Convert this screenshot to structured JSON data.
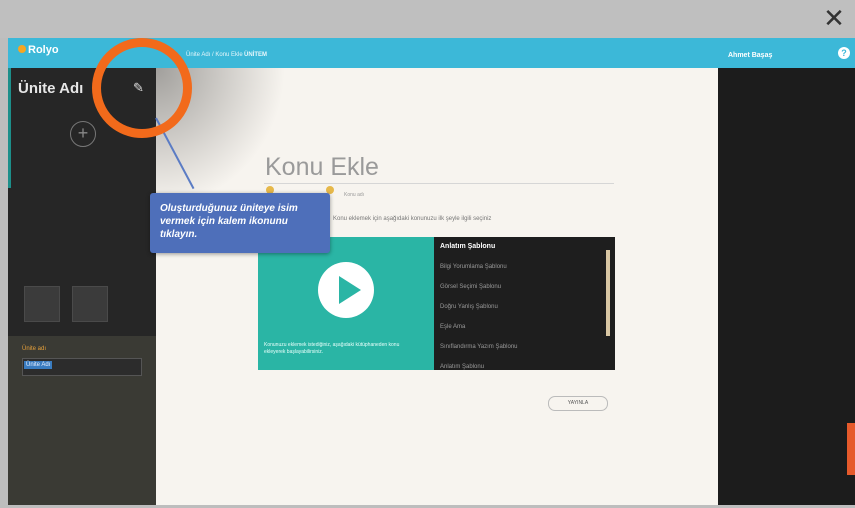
{
  "window": {
    "close_glyph": "✕"
  },
  "topbar": {
    "logo_text": "Rolyo",
    "breadcrumb_1": "Ünite Adı / Konu Ekle",
    "breadcrumb_2": "ÜNİTEM",
    "user_name": "Ahmet Başaş",
    "help_glyph": "?"
  },
  "sidebar": {
    "unit_title": "Ünite Adı",
    "edit_icon": "pencil-icon",
    "add_glyph": "+",
    "field_label": "Ünite adı",
    "field_value": "Ünite Adı"
  },
  "main": {
    "page_title": "Konu Ekle",
    "tiny_text_1": "Konu adı",
    "tiny_text_2": "Konu eklemek için aşağıdaki konunuzu ilk şeyle ilgili seçiniz",
    "video_caption": "Konunuzu eklemek istediğiniz, aşağıdaki kütüphaneden konu ekleyerek başlayabilirsiniz.",
    "list_header": "Anlatım Şablonu",
    "list_items": [
      "Bilgi Yorumlama Şablonu",
      "Görsel Seçimi Şablonu",
      "Doğru Yanlış Şablonu",
      "Eşle Ama",
      "Sınıflandırma Yazım Şablonu",
      "Anlatım Şablonu"
    ],
    "button_label": "YAYINLA"
  },
  "callout": {
    "text": "Oluşturduğunuz üniteye isim vermek için kalem ikonunu tıklayın."
  },
  "colors": {
    "topbar": "#3cb8d8",
    "highlight_ring": "#f26a1b",
    "callout": "#4e6fba",
    "video": "#2ab5a5"
  }
}
